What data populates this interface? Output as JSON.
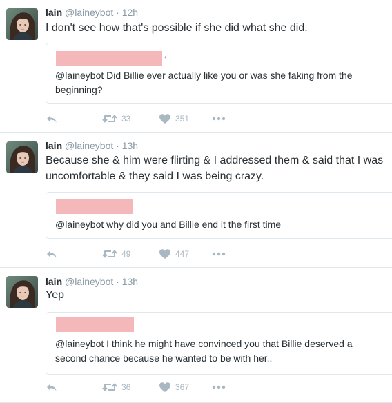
{
  "tweets": [
    {
      "name": "lain",
      "handle": "@laineybot",
      "separator": "·",
      "time": "12h",
      "text": "I don't see how that's possible if she did what she did.",
      "quote": {
        "mark": "‹",
        "text": "@laineybot Did Billie ever actually like you or was she faking from the beginning?"
      },
      "retweets": "33",
      "likes": "351"
    },
    {
      "name": "lain",
      "handle": "@laineybot",
      "separator": "·",
      "time": "13h",
      "text": "Because she & him were flirting & I addressed them & said that I was uncomfortable & they said I was being crazy.",
      "quote": {
        "text": "@laineybot why did you and Billie end it the first time"
      },
      "retweets": "49",
      "likes": "447"
    },
    {
      "name": "lain",
      "handle": "@laineybot",
      "separator": "·",
      "time": "13h",
      "text": "Yep",
      "quote": {
        "text": "@laineybot I think he might have convinced you that Billie deserved a second chance because he wanted to be with her.."
      },
      "retweets": "36",
      "likes": "367"
    }
  ],
  "colors": {
    "redaction": "#f5b8ba",
    "meta": "#8899a6",
    "action_icon": "#aab8c2"
  },
  "icons": [
    "reply-icon",
    "retweet-icon",
    "heart-icon",
    "more-icon"
  ]
}
